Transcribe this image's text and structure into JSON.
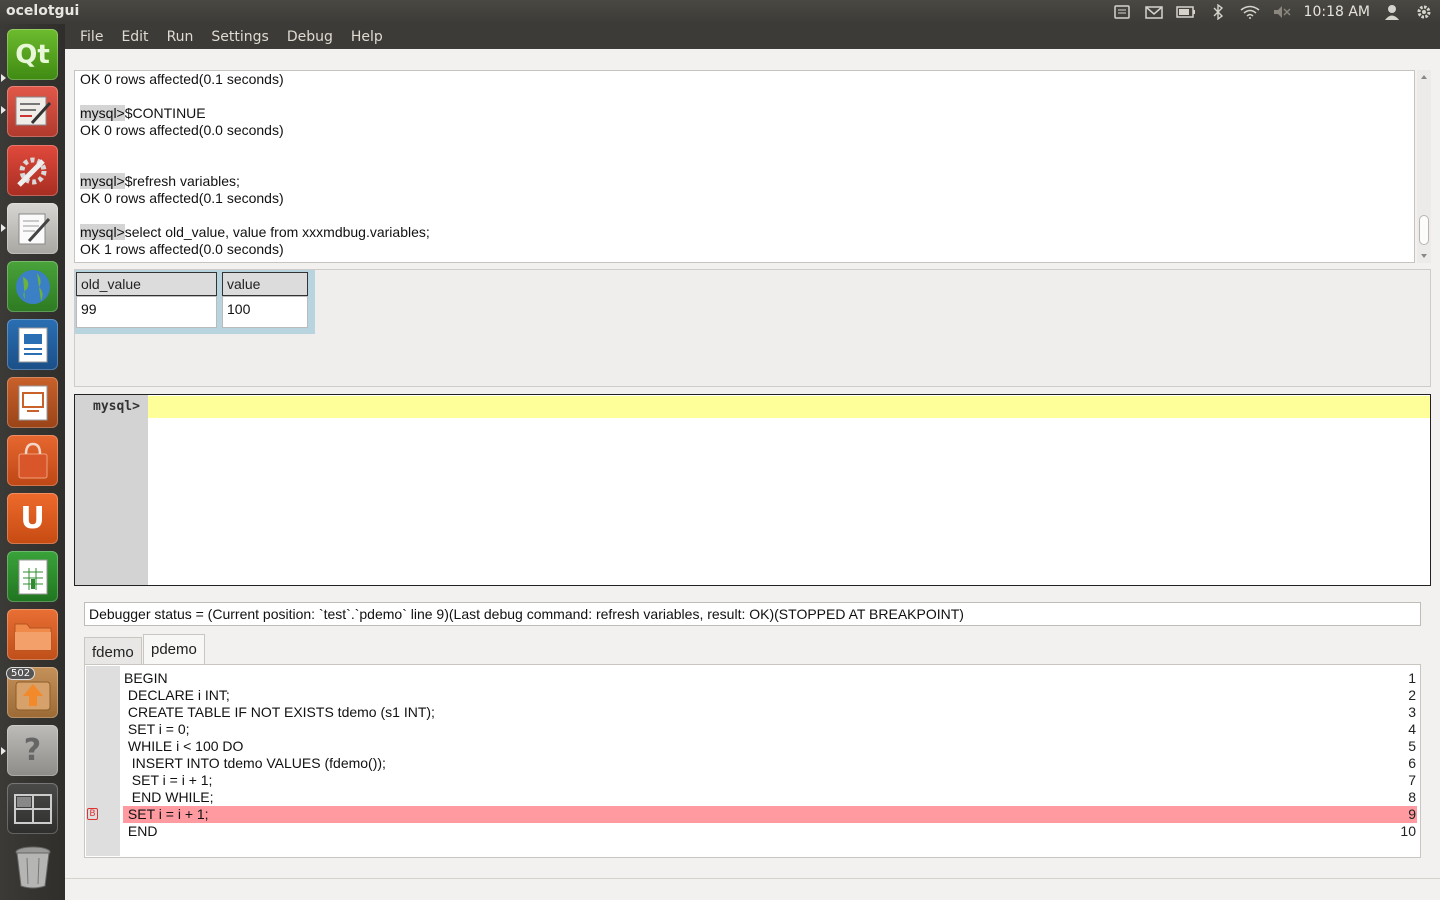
{
  "app": {
    "title": "ocelotgui"
  },
  "tray": {
    "clock": "10:18 AM",
    "icons": [
      "keyboard-icon",
      "mail-icon",
      "battery-icon",
      "bluetooth-icon",
      "wifi-icon",
      "volume-muted-icon",
      "user-icon",
      "settings-gear-icon"
    ]
  },
  "launcher": {
    "items": [
      "qt-creator",
      "system-monitor",
      "system-settings",
      "text-editor",
      "web-browser",
      "writer",
      "impress",
      "software-center",
      "ubuntu-one",
      "calc",
      "files",
      "updates",
      "help",
      "workspaces",
      "trash"
    ],
    "badge": "502"
  },
  "menu": [
    "File",
    "Edit",
    "Run",
    "Settings",
    "Debug",
    "Help"
  ],
  "history": {
    "lines": [
      {
        "prompt": "",
        "text": "OK 0 rows affected(0.1 seconds)"
      },
      {
        "prompt": "mysql>",
        "text": "$CONTINUE"
      },
      {
        "prompt": "",
        "text": "OK 0 rows affected(0.0 seconds)"
      },
      {
        "prompt": "mysql>",
        "text": "$refresh variables;"
      },
      {
        "prompt": "",
        "text": "OK 0 rows affected(0.1 seconds)"
      },
      {
        "prompt": "mysql>",
        "text": "select old_value, value from xxxmdbug.variables;"
      },
      {
        "prompt": "",
        "text": "OK 1 rows affected(0.0 seconds)"
      }
    ]
  },
  "result": {
    "columns": [
      "old_value",
      "value"
    ],
    "rows": [
      [
        "99",
        "100"
      ]
    ]
  },
  "editor": {
    "prompt": "mysql>",
    "value": ""
  },
  "status": {
    "text": "Debugger status = (Current position: `test`.`pdemo` line 9)(Last debug command: refresh variables, result: OK)(STOPPED AT BREAKPOINT)"
  },
  "tabs": [
    {
      "label": "fdemo",
      "active": false
    },
    {
      "label": "pdemo",
      "active": true
    }
  ],
  "code": {
    "breakpoint_line": 9,
    "lines": [
      {
        "n": "1",
        "text": "BEGIN"
      },
      {
        "n": "2",
        "text": " DECLARE i INT;"
      },
      {
        "n": "3",
        "text": " CREATE TABLE IF NOT EXISTS tdemo (s1 INT);"
      },
      {
        "n": "4",
        "text": " SET i = 0;"
      },
      {
        "n": "5",
        "text": " WHILE i < 100 DO"
      },
      {
        "n": "6",
        "text": "  INSERT INTO tdemo VALUES (fdemo());"
      },
      {
        "n": "7",
        "text": "  SET i = i + 1;"
      },
      {
        "n": "8",
        "text": "  END WHILE;"
      },
      {
        "n": "9",
        "text": " SET i = i + 1;"
      },
      {
        "n": "10",
        "text": " END"
      }
    ]
  }
}
